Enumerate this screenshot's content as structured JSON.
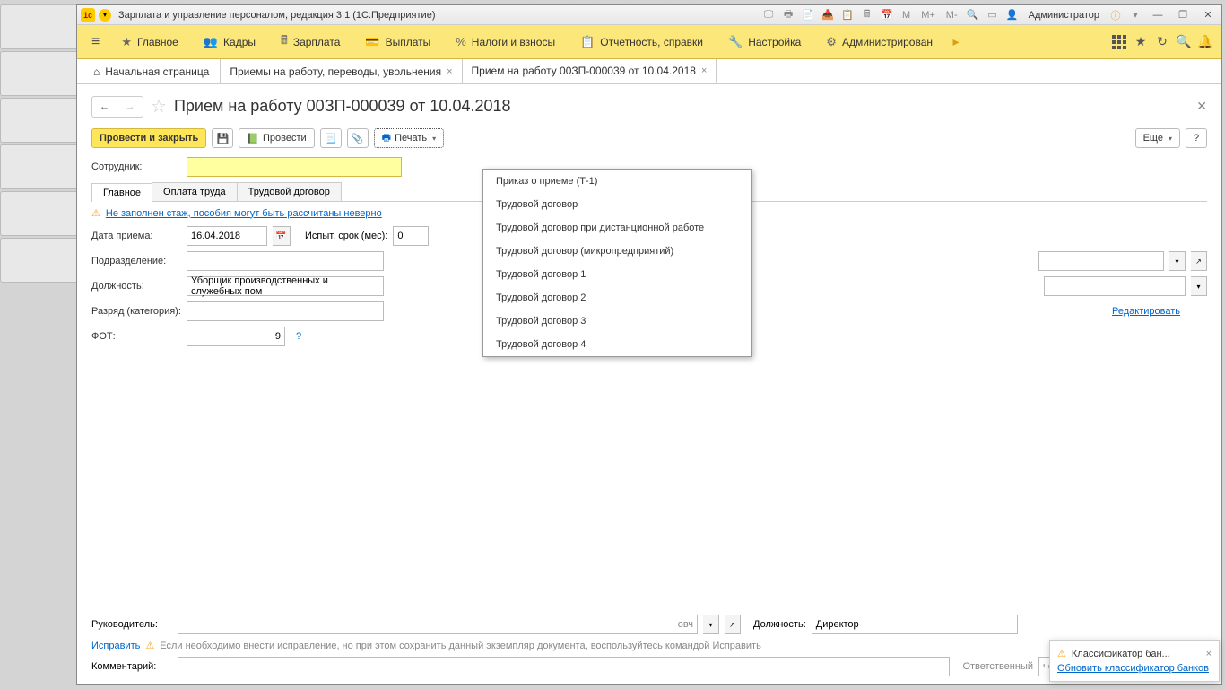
{
  "titlebar": {
    "title": "Зарплата и управление персоналом, редакция 3.1  (1С:Предприятие)",
    "m_minus": "M-",
    "m": "M",
    "m_plus": "M+",
    "admin": "Администратор"
  },
  "mainmenu": {
    "items": [
      {
        "icon": "≡",
        "label": "Главное"
      },
      {
        "icon": "👥",
        "label": "Кадры"
      },
      {
        "icon": "🖩",
        "label": "Зарплата"
      },
      {
        "icon": "💳",
        "label": "Выплаты"
      },
      {
        "icon": "%",
        "label": "Налоги и взносы"
      },
      {
        "icon": "📋",
        "label": "Отчетность, справки"
      },
      {
        "icon": "🔧",
        "label": "Настройка"
      },
      {
        "icon": "⚙",
        "label": "Администрирован"
      }
    ]
  },
  "tabs": {
    "home": "Начальная страница",
    "list": [
      {
        "label": "Приемы на работу, переводы, увольнения"
      },
      {
        "label": "Прием на работу 00ЗП-000039 от 10.04.2018"
      }
    ]
  },
  "doc": {
    "title": "Прием на работу 00ЗП-000039 от 10.04.2018"
  },
  "toolbar": {
    "post_close": "Провести и закрыть",
    "post": "Провести",
    "print": "Печать",
    "more": "Еще"
  },
  "print_menu": [
    "Приказ о приеме (Т-1)",
    "Трудовой договор",
    "Трудовой договор при дистанционной работе",
    "Трудовой договор (микропредприятий)",
    "Трудовой договор 1",
    "Трудовой договор 2",
    "Трудовой договор 3",
    "Трудовой договор 4"
  ],
  "labels": {
    "employee": "Сотрудник:",
    "tab_main": "Главное",
    "tab_pay": "Оплата труда",
    "tab_contract": "Трудовой договор",
    "warning": "Не заполнен стаж, пособия могут быть рассчитаны неверно",
    "date": "Дата приема:",
    "date_val": "16.04.2018",
    "trial": "Испыт. срок (мес):",
    "trial_val": "0",
    "dept": "Подразделение:",
    "position": "Должность:",
    "position_val": "Уборщик производственных и служебных пом",
    "grade": "Разряд (категория):",
    "fot": "ФОТ:",
    "fot_val": "9",
    "edit_link": "Редактировать",
    "leader": "Руководитель:",
    "leader_val": "овч",
    "leader_pos": "Должность:",
    "leader_pos_val": "Директор",
    "fix": "Исправить",
    "fix_hint": "Если необходимо внести исправление, но при этом сохранить данный экземпляр документа, воспользуйтесь командой Исправить",
    "comment": "Комментарий:",
    "responsible": "Ответственный",
    "responsible_val": "ченко Ирина Генна"
  },
  "notif": {
    "title": "Классификатор бан...",
    "link": "Обновить классификатор банков"
  }
}
